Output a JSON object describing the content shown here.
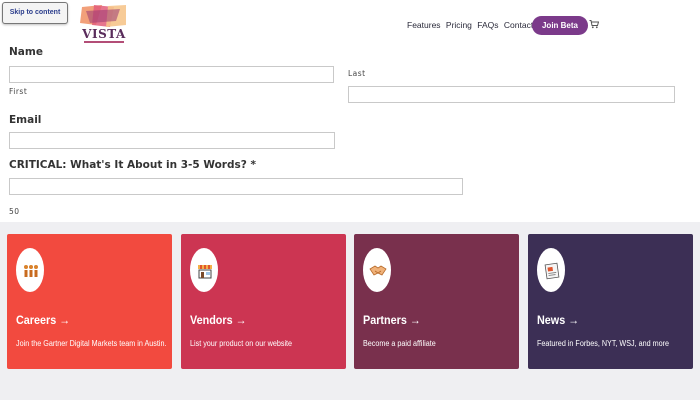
{
  "header": {
    "skip_link": "Skip to content",
    "logo_text": "VISTA",
    "nav_items": [
      "Features",
      "Pricing",
      "FAQs",
      "Contact"
    ],
    "cta": "Join Beta",
    "cart_icon": "cart-icon"
  },
  "form": {
    "name_label": "Name",
    "first_label": "First",
    "last_label": "Last",
    "email_label": "Email",
    "critical_label": "CRITICAL: What's It About in 3-5 Words? *",
    "char_count": "50"
  },
  "cards": [
    {
      "title": "Careers",
      "arrow": "→",
      "desc": "Join the Gartner Digital Markets team in Austin.",
      "color": "#f24a3f",
      "icon": "people-icon"
    },
    {
      "title": "Vendors",
      "arrow": "→",
      "desc": "List your product on our website",
      "color": "#cc3552",
      "icon": "storefront-icon"
    },
    {
      "title": "Partners",
      "arrow": "→",
      "desc": "Become a paid affiliate",
      "color": "#79304d",
      "icon": "handshake-icon"
    },
    {
      "title": "News",
      "arrow": "→",
      "desc": "Featured in Forbes, NYT, WSJ, and more",
      "color": "#3c2f55",
      "icon": "newspaper-icon"
    }
  ]
}
